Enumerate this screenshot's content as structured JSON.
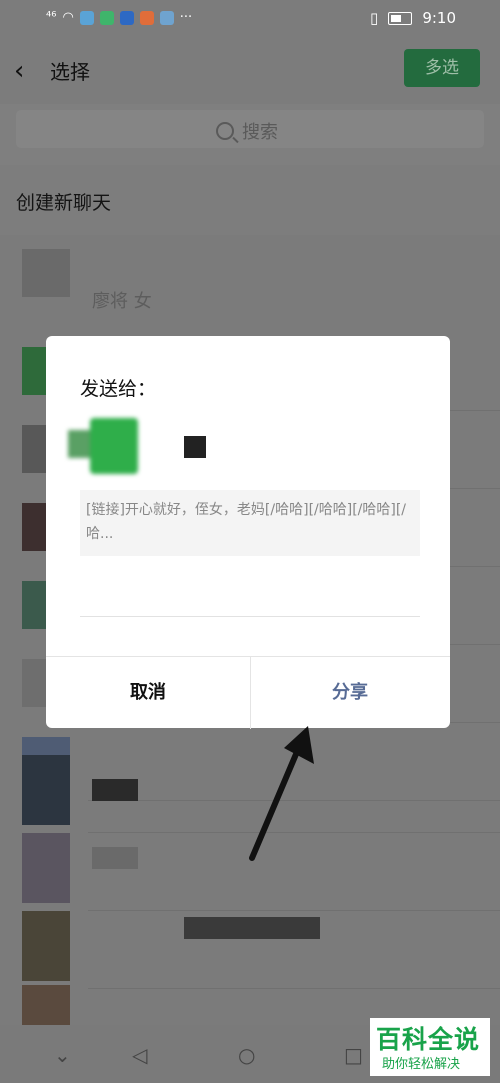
{
  "status_bar": {
    "signal": "⁴⁶",
    "more": "···",
    "time": "9:10"
  },
  "header": {
    "title": "选择",
    "multi_select": "多选"
  },
  "search": {
    "placeholder": "搜索"
  },
  "new_chat": "创建新聊天",
  "list": {
    "first_label": "廖将 女"
  },
  "dialog": {
    "title": "发送给：",
    "preview": "[链接]开心就好，侄女，老妈[/哈哈][/哈哈][/哈哈][/哈...",
    "cancel": "取消",
    "share": "分享"
  },
  "watermark": {
    "title": "百科全说",
    "subtitle": "助你轻松解决"
  },
  "colors": {
    "accent_green": "#07c160",
    "share_blue": "#576b95"
  }
}
